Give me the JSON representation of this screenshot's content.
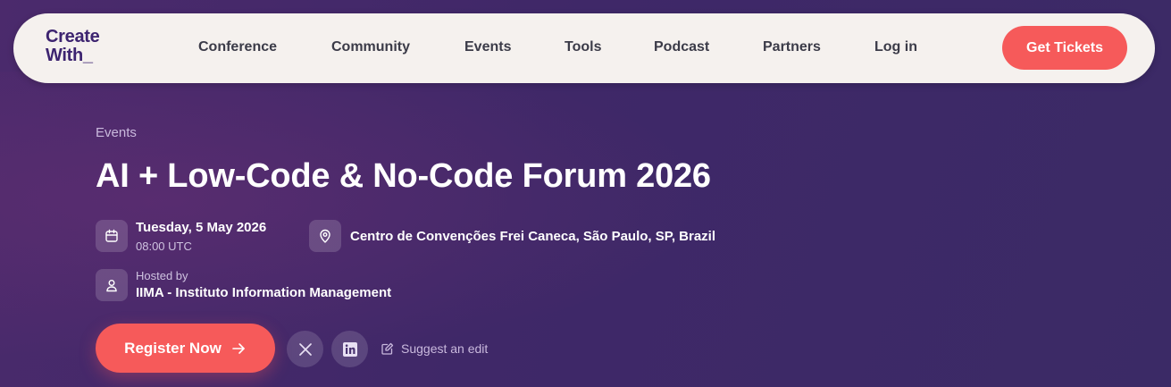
{
  "header": {
    "logo_line1": "Create",
    "logo_line2": "With_",
    "nav": [
      {
        "label": "Conference"
      },
      {
        "label": "Community"
      },
      {
        "label": "Events"
      },
      {
        "label": "Tools"
      },
      {
        "label": "Podcast"
      },
      {
        "label": "Partners"
      },
      {
        "label": "Log in"
      }
    ],
    "cta_label": "Get Tickets"
  },
  "event": {
    "breadcrumb": "Events",
    "title": "AI + Low-Code & No-Code Forum 2026",
    "date": "Tuesday, 5 May 2026",
    "time": "08:00 UTC",
    "location": "Centro de Convenções Frei Caneca, São Paulo, SP, Brazil",
    "hosted_label": "Hosted by",
    "host": "IIMA - Instituto Information Management"
  },
  "actions": {
    "register_label": "Register Now",
    "suggest_label": "Suggest an edit"
  },
  "colors": {
    "background": "#432a6a",
    "accent": "#f65a5a",
    "navbar": "#f5f1ee",
    "logo": "#3d2470"
  },
  "icons": [
    "calendar-icon",
    "map-pin-icon",
    "user-icon",
    "arrow-right-icon",
    "x-icon",
    "linkedin-icon",
    "edit-icon"
  ]
}
